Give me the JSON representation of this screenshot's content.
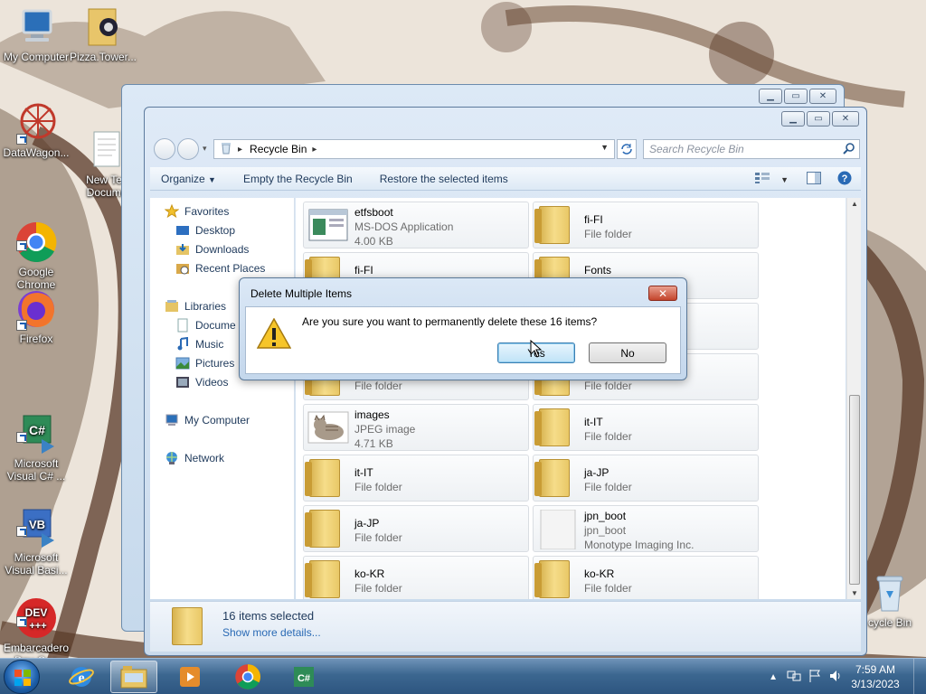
{
  "desktop": {
    "icons": {
      "my_computer": "My Computer",
      "pizza_tower": "Pizza.Tower...",
      "datawagon": "DataWagon...",
      "new_text": "New Tex\nDocume",
      "chrome": "Google\nChrome",
      "firefox": "Firefox",
      "vcsharp": "Microsoft\nVisual C# ...",
      "vbasic": "Microsoft\nVisual Basi...",
      "embarcadero": "Embarcadero\nDev-C++",
      "recycle_bin": "cycle Bin"
    }
  },
  "explorer": {
    "address": {
      "crumb": "Recycle Bin",
      "search_placeholder": "Search Recycle Bin"
    },
    "toolbar": {
      "organize": "Organize",
      "empty": "Empty the Recycle Bin",
      "restore": "Restore the selected items"
    },
    "nav": {
      "favorites": "Favorites",
      "desktop": "Desktop",
      "downloads": "Downloads",
      "recent": "Recent Places",
      "libraries": "Libraries",
      "documents": "Docume",
      "music": "Music",
      "pictures": "Pictures",
      "videos": "Videos",
      "my_computer": "My Computer",
      "network": "Network"
    },
    "files": [
      {
        "name": "etfsboot",
        "line1": "MS-DOS Application",
        "line2": "4.00 KB"
      },
      {
        "name": "fi-FI",
        "line1": "File folder",
        "line2": ""
      },
      {
        "name": "fi-FI",
        "line1": "",
        "line2": ""
      },
      {
        "name": "Fonts",
        "line1": "",
        "line2": ""
      },
      {
        "name": "",
        "line1": "File folder",
        "line2": ""
      },
      {
        "name": "",
        "line1": "File folder",
        "line2": ""
      },
      {
        "name": "images",
        "line1": "JPEG image",
        "line2": "4.71 KB"
      },
      {
        "name": "it-IT",
        "line1": "File folder",
        "line2": ""
      },
      {
        "name": "it-IT",
        "line1": "File folder",
        "line2": ""
      },
      {
        "name": "ja-JP",
        "line1": "File folder",
        "line2": ""
      },
      {
        "name": "ja-JP",
        "line1": "File folder",
        "line2": ""
      },
      {
        "name": "jpn_boot",
        "line1": "jpn_boot",
        "line2": "Monotype Imaging Inc."
      },
      {
        "name": "ko-KR",
        "line1": "File folder",
        "line2": ""
      },
      {
        "name": "ko-KR",
        "line1": "File folder",
        "line2": ""
      }
    ],
    "details": {
      "title": "16 items selected",
      "link": "Show more details..."
    }
  },
  "dialog": {
    "title": "Delete Multiple Items",
    "message": "Are you sure you want to permanently delete these 16 items?",
    "yes_label": "Yes",
    "no_label": "No",
    "close_glyph": "✕"
  },
  "taskbar": {
    "time": "7:59 AM",
    "date": "3/13/2023"
  },
  "colors": {
    "accent": "#2a6ab5",
    "taskbar": "#3c6790",
    "close_button": "#c3442b"
  }
}
